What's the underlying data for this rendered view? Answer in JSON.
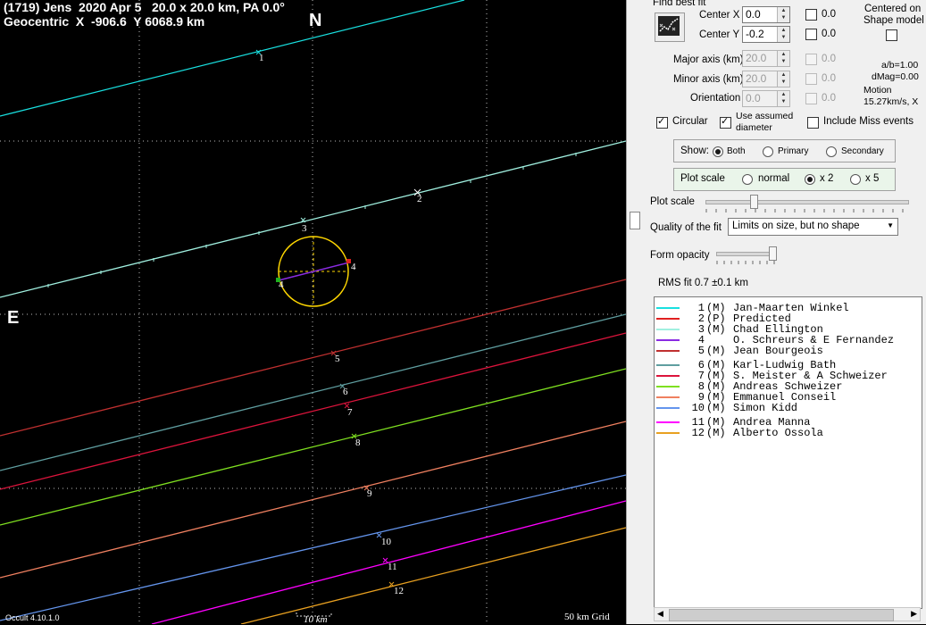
{
  "header": {
    "line1": "(1719) Jens  2020 Apr 5   20.0 x 20.0 km, PA 0.0°",
    "line2": "Geocentric  X  -906.6  Y 6068.9 km"
  },
  "compass": {
    "north": "N",
    "east": "E"
  },
  "footer": {
    "version": "Occult 4.10.1.0",
    "scale_bar": "10 km",
    "grid": "50 km Grid"
  },
  "chord_labels": [
    "1",
    "2",
    "3",
    "4",
    "4",
    "5",
    "6",
    "7",
    "8",
    "9",
    "10",
    "11",
    "12"
  ],
  "panel": {
    "find_best_fit": "Find best fit",
    "center_x": {
      "label": "Center X",
      "value": "0.0",
      "shift": "0.0"
    },
    "center_y": {
      "label": "Center Y",
      "value": "-0.2",
      "shift": "0.0"
    },
    "major_axis": {
      "label": "Major axis (km)",
      "value": "20.0",
      "shift": "0.0"
    },
    "minor_axis": {
      "label": "Minor axis (km)",
      "value": "20.0",
      "shift": "0.0"
    },
    "orientation": {
      "label": "Orientation",
      "value": "0.0",
      "shift": "0.0"
    },
    "centered_on": "Centered on",
    "shape_model": "Shape model",
    "ab": "a/b=1.00",
    "dmag": "dMag=0.00",
    "motion_label": "Motion",
    "motion_value": "15.27km/s, X",
    "circular": "Circular",
    "use_assumed_1": "Use assumed",
    "use_assumed_2": "diameter",
    "include_miss": "Include Miss events",
    "show_label": "Show:",
    "show_both": "Both",
    "show_primary": "Primary",
    "show_secondary": "Secondary",
    "plot_scale_group": "Plot scale",
    "scale_normal": "normal",
    "scale_x2": "x 2",
    "scale_x5": "x 5",
    "plot_scale": "Plot scale",
    "quality_label": "Quality of the fit",
    "quality_value": "Limits on size, but no shape",
    "form_opacity": "Form opacity",
    "rms": "RMS fit 0.7 ±0.1 km"
  },
  "observers": [
    {
      "num": "1",
      "type": "(M)",
      "name": "Jan-Maarten Winkel",
      "color": "#19e0e0"
    },
    {
      "num": "2",
      "type": "(P)",
      "name": "Predicted",
      "color": "#e02020"
    },
    {
      "num": "3",
      "type": "(M)",
      "name": "Chad Ellington",
      "color": "#a0f0e0"
    },
    {
      "num": "4",
      "type": "",
      "name": "O. Schreurs & E Fernandez",
      "color": "#8a2be2"
    },
    {
      "num": "5",
      "type": "(M)",
      "name": "Jean Bourgeois",
      "color": "#c03030"
    },
    {
      "num": "6",
      "type": "(M)",
      "name": "Karl-Ludwig Bath",
      "color": "#5f9ea0"
    },
    {
      "num": "7",
      "type": "(M)",
      "name": "S. Meister & A Schweizer",
      "color": "#dc143c"
    },
    {
      "num": "8",
      "type": "(M)",
      "name": "Andreas Schweizer",
      "color": "#7fe020"
    },
    {
      "num": "9",
      "type": "(M)",
      "name": "Emmanuel Conseil",
      "color": "#f08060"
    },
    {
      "num": "10",
      "type": "(M)",
      "name": "Simon Kidd",
      "color": "#6495ed"
    },
    {
      "num": "11",
      "type": "(M)",
      "name": "Andrea Manna",
      "color": "#ff00ff"
    },
    {
      "num": "12",
      "type": "(M)",
      "name": "Alberto Ossola",
      "color": "#e8a020"
    }
  ]
}
